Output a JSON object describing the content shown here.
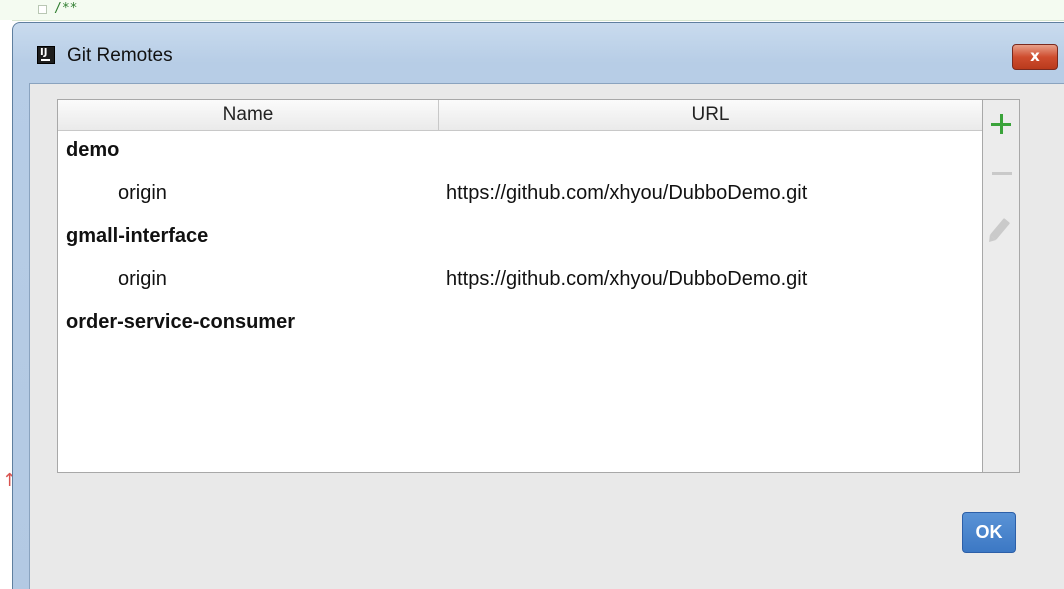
{
  "editor": {
    "code_snippet": "/**"
  },
  "dialog": {
    "title": "Git Remotes",
    "app_icon_text": "IJ",
    "close_label": "x",
    "ok_label": "OK"
  },
  "table": {
    "columns": [
      "Name",
      "URL"
    ],
    "rows": [
      {
        "kind": "group",
        "name": "demo",
        "url": ""
      },
      {
        "kind": "child",
        "name": "origin",
        "url": "https://github.com/xhyou/DubboDemo.git"
      },
      {
        "kind": "group",
        "name": "gmall-interface",
        "url": ""
      },
      {
        "kind": "child",
        "name": "origin",
        "url": "https://github.com/xhyou/DubboDemo.git"
      },
      {
        "kind": "group",
        "name": "order-service-consumer",
        "url": ""
      }
    ]
  },
  "toolbar": {
    "icons": [
      "add-icon",
      "remove-icon",
      "edit-icon"
    ]
  },
  "colors": {
    "add_green": "#3aa33a",
    "ok_blue": "#3c78c4",
    "close_red": "#cf4d2f"
  }
}
